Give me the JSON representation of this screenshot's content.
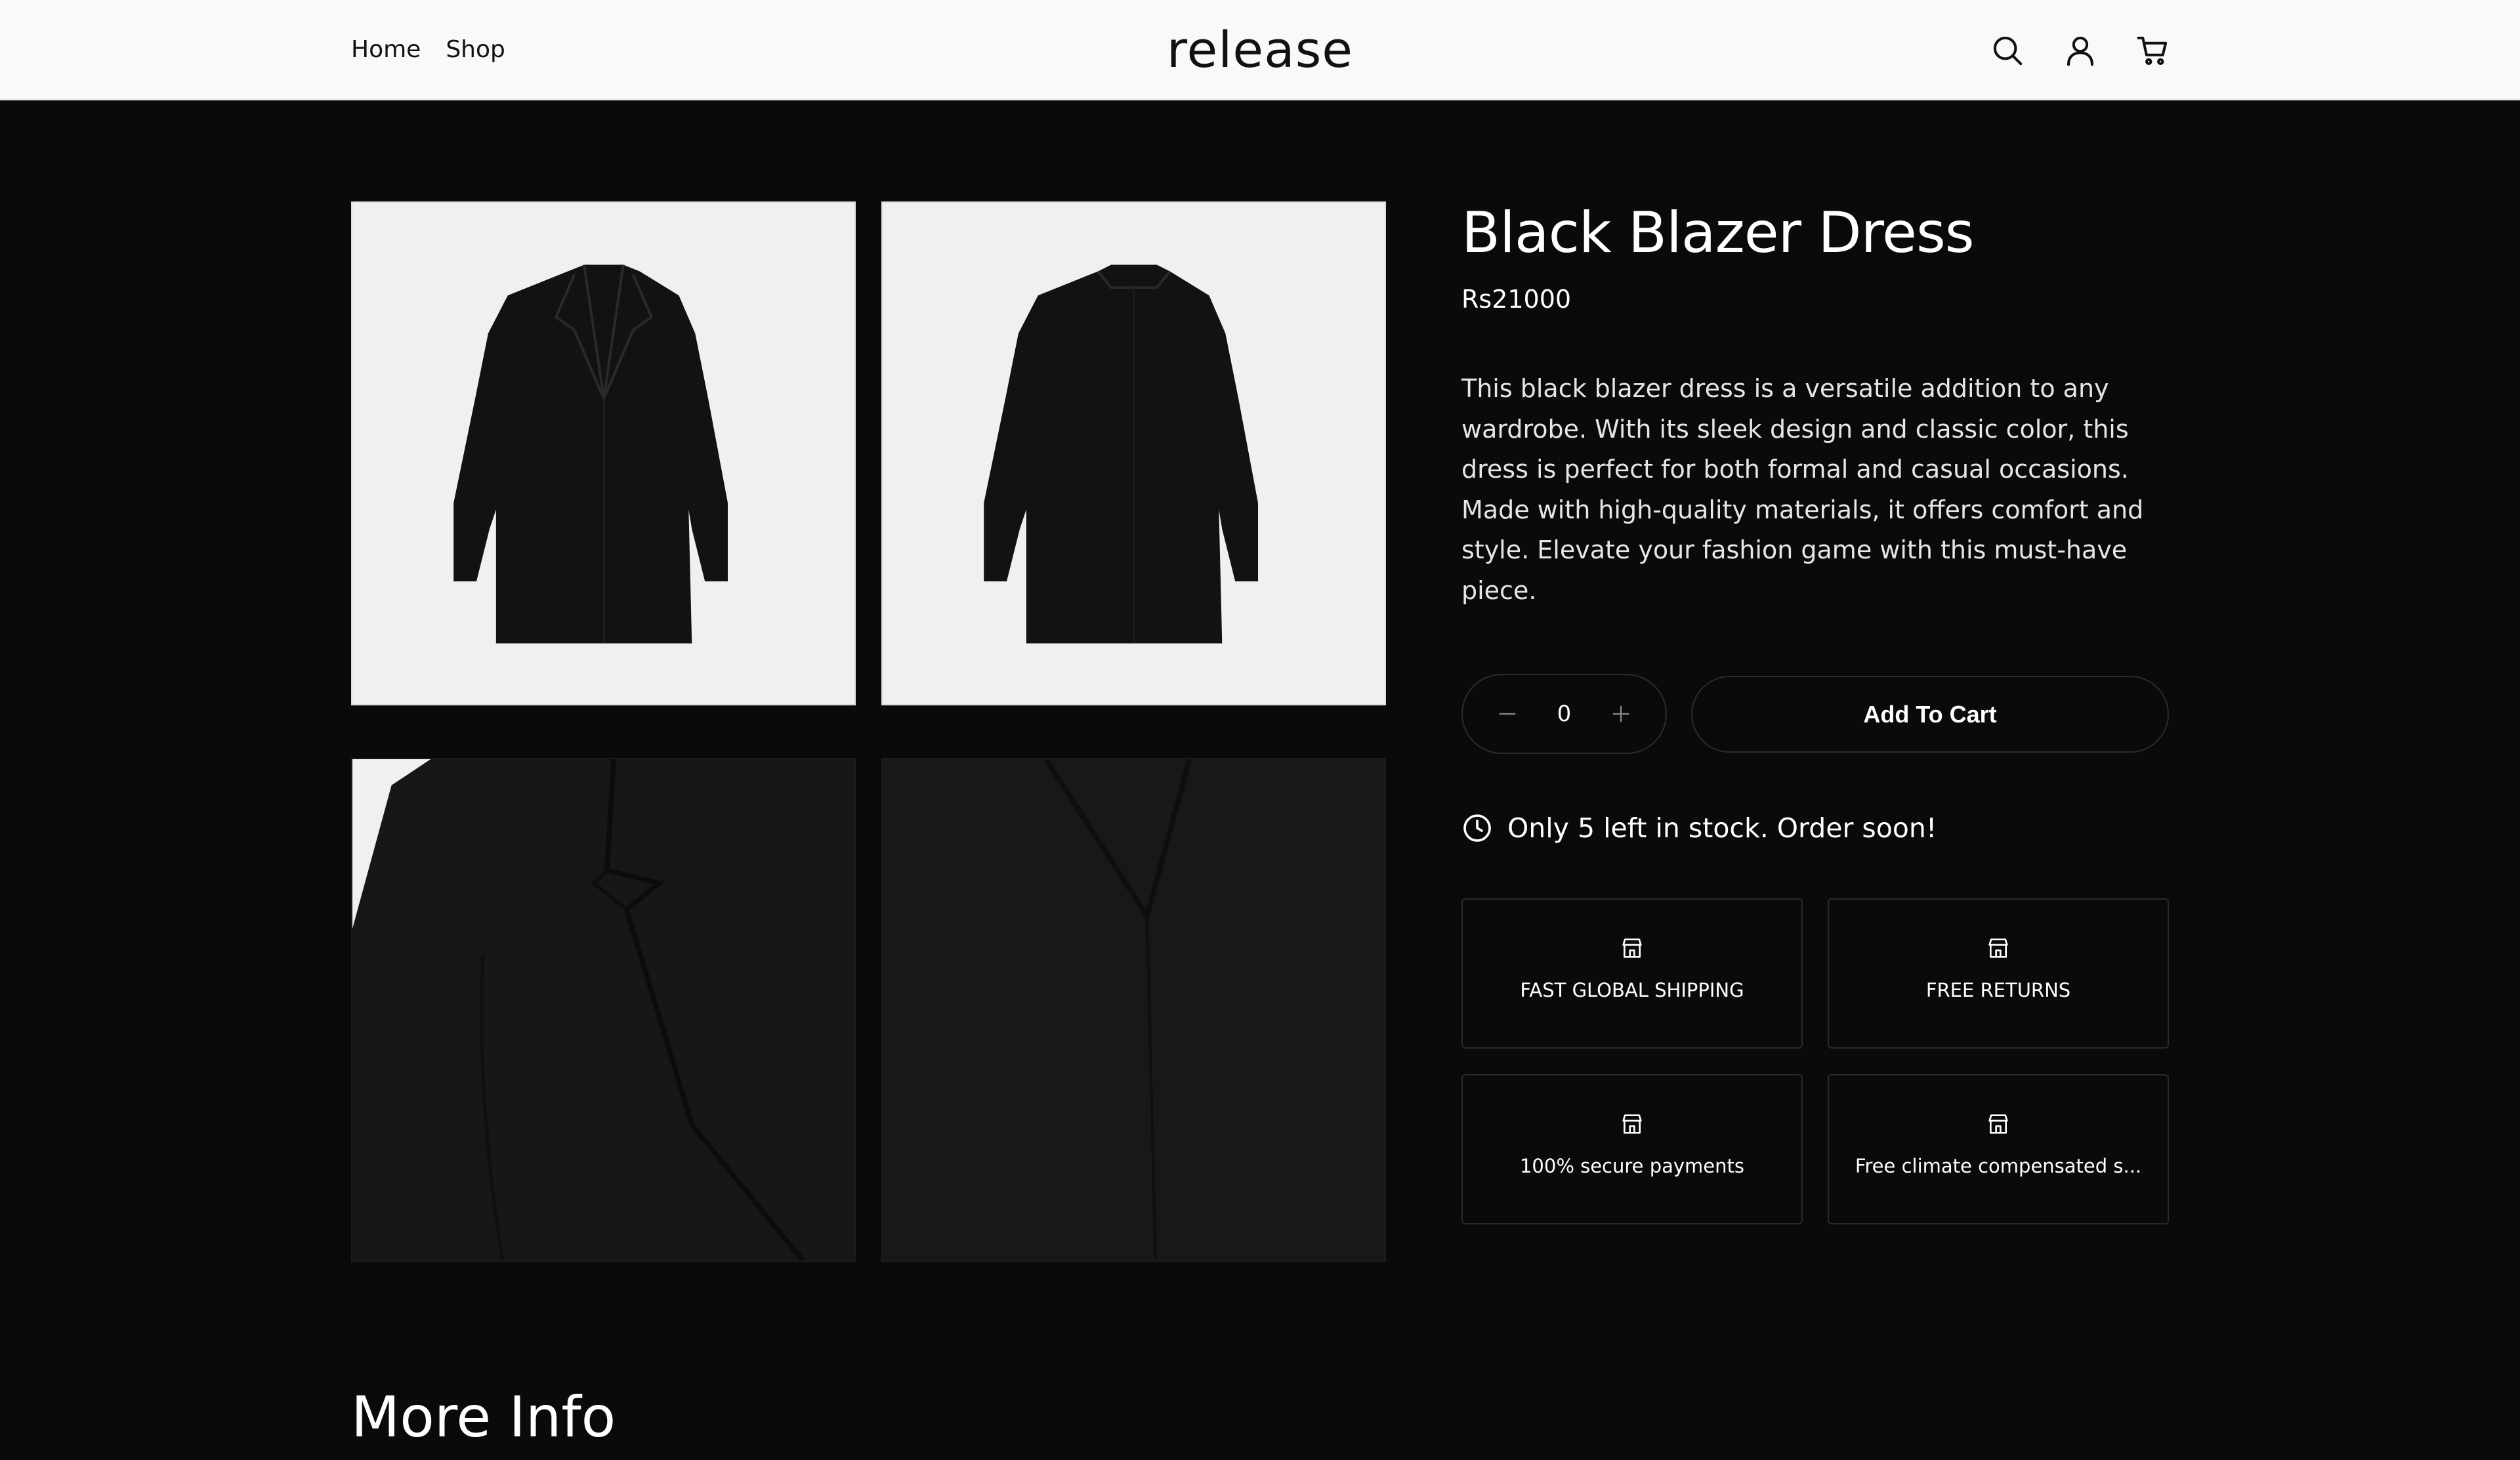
{
  "header": {
    "nav": [
      {
        "label": "Home"
      },
      {
        "label": "Shop"
      }
    ],
    "logo": "release",
    "icons": [
      "search-icon",
      "account-icon",
      "cart-icon"
    ]
  },
  "gallery": {
    "images": [
      {
        "name": "front view"
      },
      {
        "name": "back view"
      },
      {
        "name": "lapel detail"
      },
      {
        "name": "fabric close-up"
      }
    ]
  },
  "product": {
    "title": "Black Blazer Dress",
    "price": "Rs21000",
    "description": "This black blazer dress is a versatile addition to any wardrobe. With its sleek design and classic color, this dress is perfect for both formal and casual occasions. Made with high-quality materials, it offers comfort and style. Elevate your fashion game with this must-have piece.",
    "quantity": "0",
    "add_to_cart_label": "Add To Cart",
    "stock_message": "Only 5 left in stock. Order soon!"
  },
  "features": [
    {
      "label": "FAST GLOBAL SHIPPING",
      "icon": "store-icon"
    },
    {
      "label": "FREE RETURNS",
      "icon": "store-icon"
    },
    {
      "label": "100% secure payments",
      "icon": "store-icon"
    },
    {
      "label": "Free climate compensated s...",
      "icon": "store-icon"
    }
  ],
  "more_info": {
    "heading": "More Info"
  },
  "colors": {
    "page_background": "#0a0a0a",
    "header_background": "#f9f9f9",
    "text_primary": "#ffffff",
    "header_text": "#111111",
    "border": "#2c2c2c"
  }
}
